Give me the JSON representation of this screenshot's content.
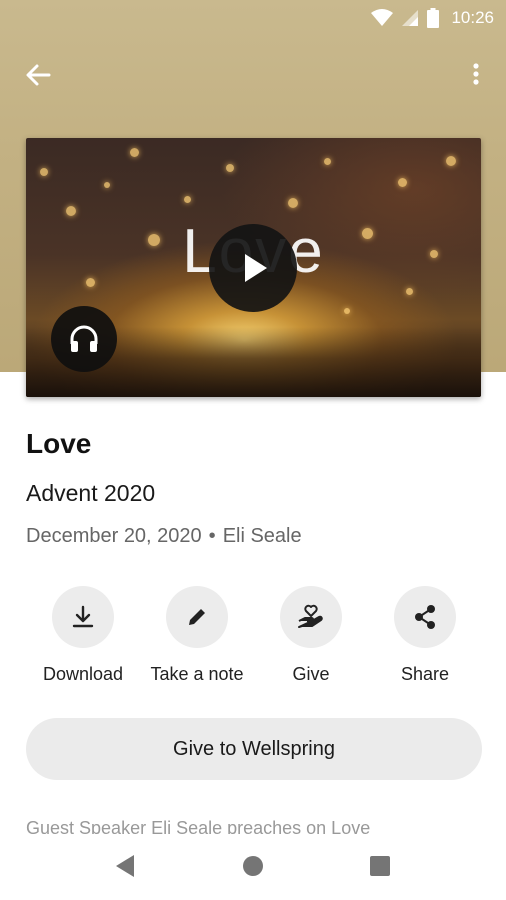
{
  "status_bar": {
    "time": "10:26",
    "icons": [
      "wifi-icon",
      "signal-icon",
      "battery-icon"
    ]
  },
  "app_bar": {
    "back_icon": "arrow-back-icon",
    "more_icon": "more-vert-icon"
  },
  "media": {
    "artwork_title": "Love",
    "play_icon": "play-icon",
    "audio_icon": "headphones-icon"
  },
  "sermon": {
    "title": "Love",
    "series": "Advent 2020",
    "date": "December 20, 2020",
    "separator": "•",
    "speaker": "Eli Seale"
  },
  "actions": [
    {
      "label": "Download",
      "icon": "download-icon"
    },
    {
      "label": "Take a note",
      "icon": "pencil-icon"
    },
    {
      "label": "Give",
      "icon": "hand-heart-icon"
    },
    {
      "label": "Share",
      "icon": "share-icon"
    }
  ],
  "give_button": {
    "label": "Give to Wellspring"
  },
  "description": "Guest Speaker Eli Seale preaches on Love",
  "nav_bar": {
    "icons": [
      "nav-back-icon",
      "nav-home-icon",
      "nav-recents-icon"
    ]
  },
  "colors": {
    "hero": "#c3b183",
    "button_bg": "#ebebeb",
    "meta_text": "#666666"
  }
}
